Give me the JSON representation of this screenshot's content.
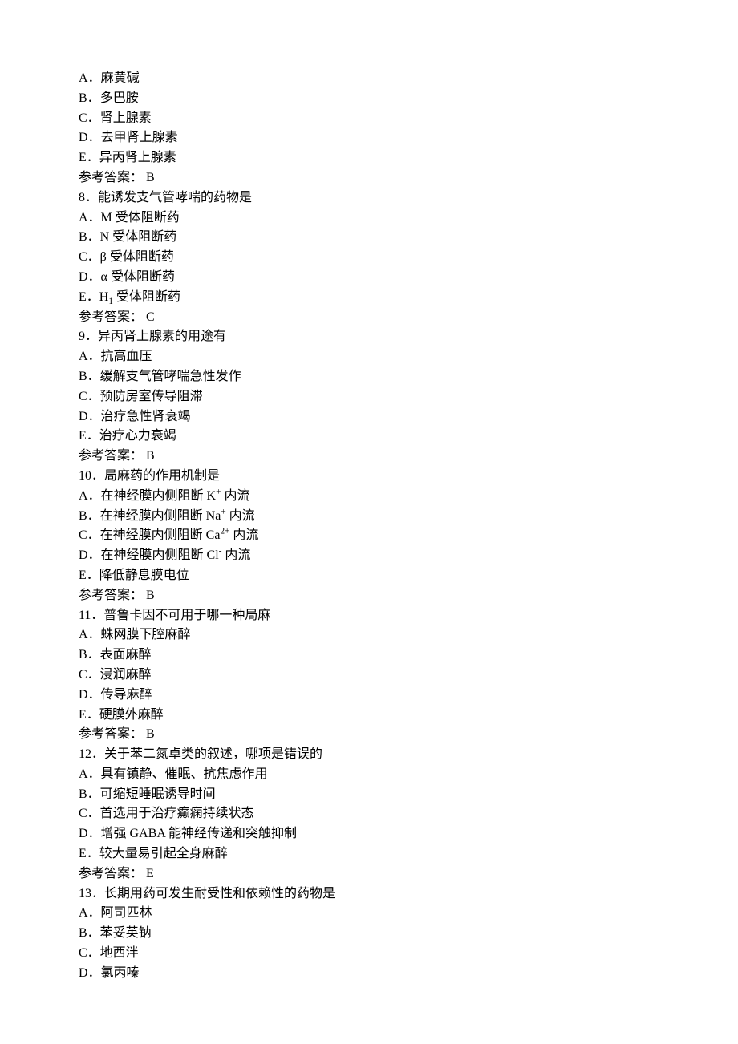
{
  "q7": {
    "options": {
      "A": "麻黄碱",
      "B": "多巴胺",
      "C": "肾上腺素",
      "D": "去甲肾上腺素",
      "E": "异丙肾上腺素"
    },
    "answer_label": "参考答案： B"
  },
  "q8": {
    "stem": "8．能诱发支气管哮喘的药物是",
    "options": {
      "A": "A．M 受体阻断药",
      "B": "B．N 受体阻断药",
      "C": "C．β 受体阻断药",
      "D_pre": "D．α 受体阻断药",
      "E_pre": "E．H",
      "E_sub": "1",
      "E_post": " 受体阻断药"
    },
    "answer_label": "参考答案： C"
  },
  "q9": {
    "stem": "9．异丙肾上腺素的用途有",
    "options": {
      "A": "A．抗高血压",
      "B": "B．缓解支气管哮喘急性发作",
      "C": "C．预防房室传导阻滞",
      "D": "D．治疗急性肾衰竭",
      "E": "E．治疗心力衰竭"
    },
    "answer_label": "参考答案： B"
  },
  "q10": {
    "stem": "10．局麻药的作用机制是",
    "options": {
      "A_pre": "A．在神经膜内侧阻断 K",
      "A_sup": "+",
      "A_post": " 内流",
      "B_pre": "B．在神经膜内侧阻断 Na",
      "B_sup": "+",
      "B_post": " 内流",
      "C_pre": "C．在神经膜内侧阻断 Ca",
      "C_sup": "2+",
      "C_post": " 内流",
      "D_pre": "D．在神经膜内侧阻断 Cl",
      "D_sup": "-",
      "D_post": " 内流",
      "E": "E．降低静息膜电位"
    },
    "answer_label": "参考答案： B"
  },
  "q11": {
    "stem": "11．普鲁卡因不可用于哪一种局麻",
    "options": {
      "A": "A．蛛网膜下腔麻醉",
      "B": "B．表面麻醉",
      "C": "C．浸润麻醉",
      "D": "D．传导麻醉",
      "E": "E．硬膜外麻醉"
    },
    "answer_label": "参考答案： B"
  },
  "q12": {
    "stem": "12．关于苯二氮卓类的叙述，哪项是错误的",
    "options": {
      "A": "A．具有镇静、催眠、抗焦虑作用",
      "B": "B．可缩短睡眠诱导时间",
      "C": "C．首选用于治疗癫痫持续状态",
      "D": "D．增强 GABA 能神经传递和突触抑制",
      "E": "E．较大量易引起全身麻醉"
    },
    "answer_label": "参考答案： E"
  },
  "q13": {
    "stem": "13．长期用药可发生耐受性和依赖性的药物是",
    "options": {
      "A": "A．阿司匹林",
      "B": "B．苯妥英钠",
      "C": "C．地西泮",
      "D": "D．氯丙嗪"
    }
  },
  "labels": {
    "A": "A．",
    "B": "B．",
    "C": "C．",
    "D": "D．",
    "E": "E．"
  }
}
